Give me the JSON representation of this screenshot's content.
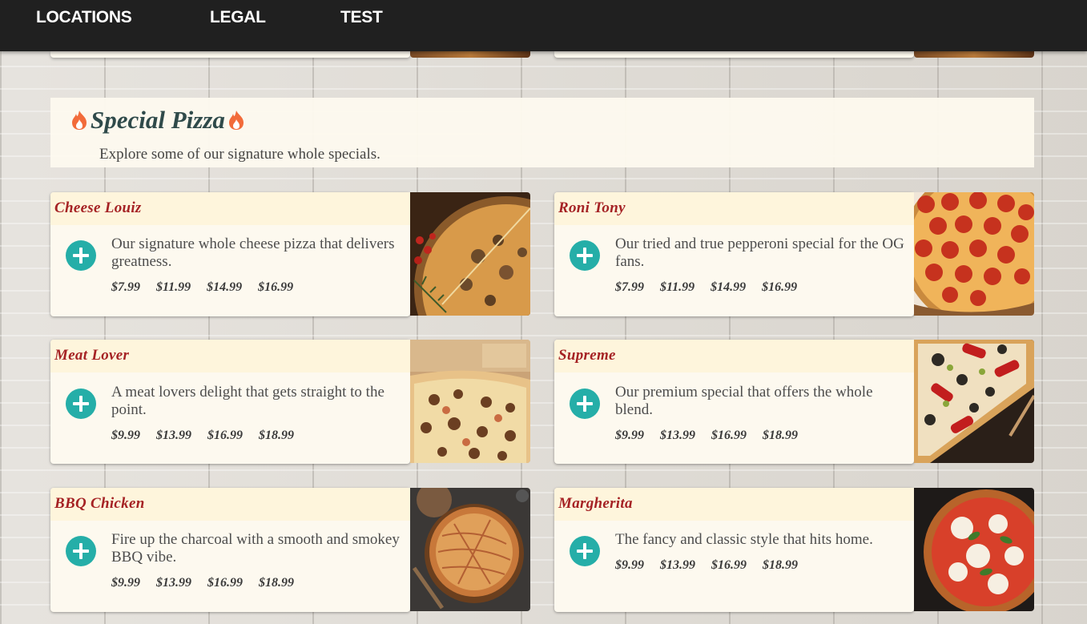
{
  "nav": {
    "items": [
      {
        "label": "LOCATIONS"
      },
      {
        "label": "LEGAL"
      },
      {
        "label": "TEST"
      }
    ]
  },
  "section": {
    "title": "Special Pizza",
    "subtitle": "Explore some of our signature whole specials.",
    "title_icon": "flame-icon",
    "colors": {
      "title": "#2f4a4a",
      "item_name": "#a52224",
      "add_button": "#25aea8",
      "flame": "#f26b3a"
    }
  },
  "items": [
    {
      "name": "Cheese Louiz",
      "description": "Our signature whole cheese pizza that delivers greatness.",
      "prices": [
        "$7.99",
        "$11.99",
        "$14.99",
        "$16.99"
      ],
      "image": "cheese-pizza-photo"
    },
    {
      "name": "Roni Tony",
      "description": "Our tried and true pepperoni special for the OG fans.",
      "prices": [
        "$7.99",
        "$11.99",
        "$14.99",
        "$16.99"
      ],
      "image": "pepperoni-pizza-photo"
    },
    {
      "name": "Meat Lover",
      "description": "A meat lovers delight that gets straight to the point.",
      "prices": [
        "$9.99",
        "$13.99",
        "$16.99",
        "$18.99"
      ],
      "image": "meat-pizza-photo"
    },
    {
      "name": "Supreme",
      "description": "Our premium special that offers the whole blend.",
      "prices": [
        "$9.99",
        "$13.99",
        "$16.99",
        "$18.99"
      ],
      "image": "supreme-pizza-photo"
    },
    {
      "name": "BBQ Chicken",
      "description": "Fire up the charcoal with a smooth and smokey BBQ vibe.",
      "prices": [
        "$9.99",
        "$13.99",
        "$16.99",
        "$18.99"
      ],
      "image": "bbq-chicken-pizza-photo"
    },
    {
      "name": "Margherita",
      "description": "The fancy and classic style that hits home.",
      "prices": [
        "$9.99",
        "$13.99",
        "$16.99",
        "$18.99"
      ],
      "image": "margherita-pizza-photo"
    }
  ]
}
